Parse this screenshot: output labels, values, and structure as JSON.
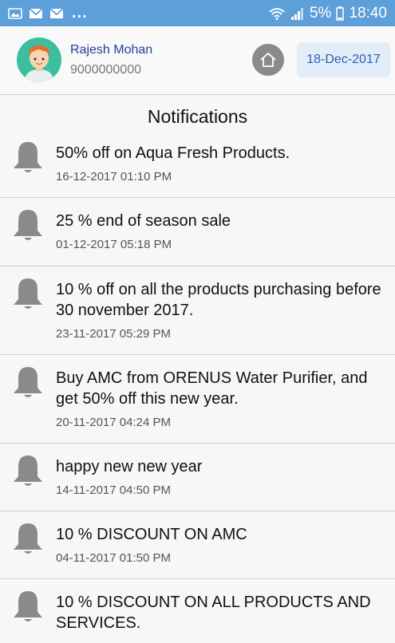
{
  "status_bar": {
    "battery": "5%",
    "time": "18:40",
    "more": "..."
  },
  "header": {
    "user_name": "Rajesh Mohan",
    "phone": "9000000000",
    "date": "18-Dec-2017"
  },
  "notifications": {
    "title": "Notifications",
    "items": [
      {
        "message": "50% off on Aqua Fresh Products.",
        "time": "16-12-2017 01:10 PM"
      },
      {
        "message": "25 % end of season sale",
        "time": "01-12-2017 05:18 PM"
      },
      {
        "message": "10 % off on all the products purchasing before 30 november 2017.",
        "time": "23-11-2017 05:29 PM"
      },
      {
        "message": "Buy AMC from ORENUS Water Purifier, and get 50% off this new year.",
        "time": "20-11-2017 04:24 PM"
      },
      {
        "message": "happy new new year",
        "time": "14-11-2017 04:50 PM"
      },
      {
        "message": "10 % DISCOUNT ON AMC",
        "time": "04-11-2017 01:50 PM"
      },
      {
        "message": "10 % DISCOUNT ON ALL PRODUCTS AND SERVICES.",
        "time": ""
      }
    ]
  },
  "colors": {
    "status_bar": "#5d9fd9",
    "user_name": "#1f3e9c",
    "date_bg": "#e3edf9",
    "bell": "#8a8a8a"
  }
}
